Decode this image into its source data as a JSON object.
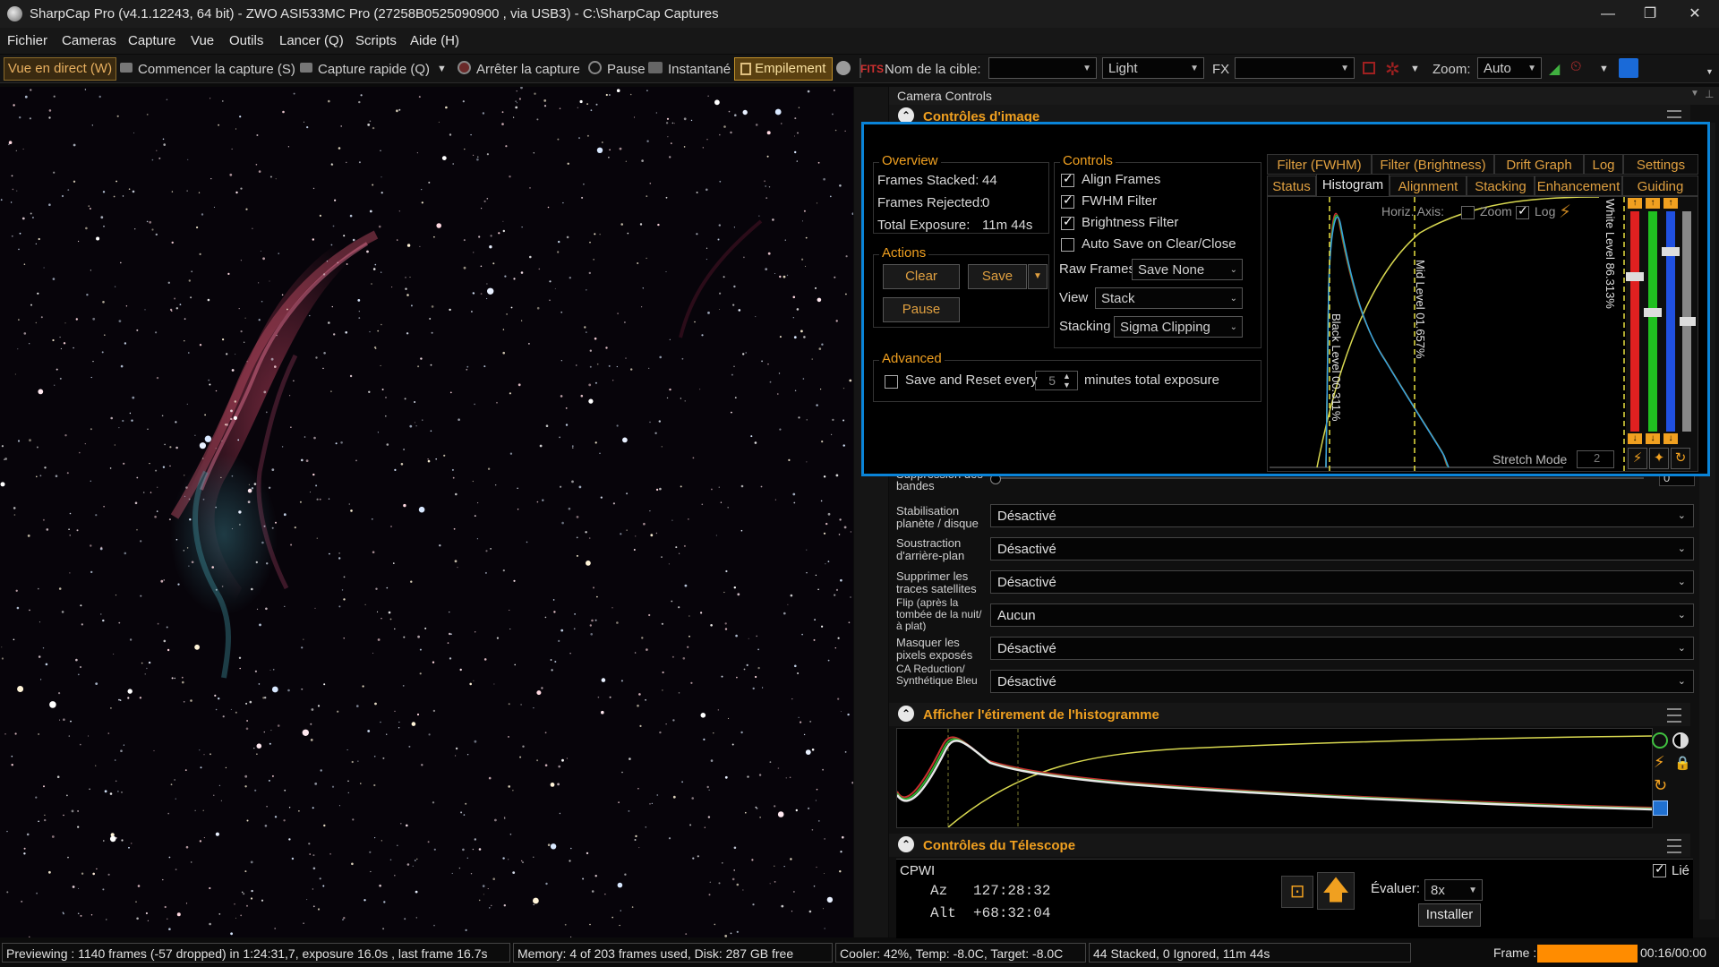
{
  "window": {
    "title": "SharpCap Pro (v4.1.12243, 64 bit) - ZWO ASI533MC Pro (27258B0525090900 , via USB3) - C:\\SharpCap Captures",
    "minimize": "—",
    "maximize": "❐",
    "close": "✕"
  },
  "menu": [
    "Fichier",
    "Cameras",
    "Capture",
    "Vue",
    "Outils",
    "Lancer (Q)",
    "Scripts",
    "Aide (H)"
  ],
  "toolbar": {
    "live_view": "Vue en direct (W)",
    "start_capture": "Commencer la capture (S)",
    "quick_capture": "Capture rapide (Q)",
    "stop_capture": "Arrêter la capture",
    "pause": "Pause",
    "snapshot": "Instantané",
    "live_stack": "Empilement",
    "target_name_label": "Nom de la cible:",
    "target_name_value": "",
    "frame_type": "Light",
    "fx_label": "FX",
    "fx_value": "",
    "zoom_label": "Zoom:",
    "zoom_value": "Auto"
  },
  "right_panel": {
    "header": "Camera Controls",
    "image_controls_title": "Contrôles d'image",
    "banding_label": "Suppression des bandes",
    "banding_value": "0",
    "rows": [
      {
        "label": "Stabilisation planète / disque",
        "value": "Désactivé"
      },
      {
        "label": "Soustraction d'arrière-plan",
        "value": "Désactivé"
      },
      {
        "label": "Supprimer les traces satellites",
        "value": "Désactivé"
      },
      {
        "label": "Flip (après la tombée de la nuit/à plat)",
        "value": "Aucun"
      },
      {
        "label": "Masquer les pixels exposés",
        "value": "Désactivé"
      },
      {
        "label": "CA Reduction/ Synthétique Bleu",
        "value": "Désactivé"
      }
    ],
    "histogram_stretch_title": "Afficher l'étirement de l'histogramme",
    "telescope_title": "Contrôles du Télescope",
    "telescope": {
      "mount": "CPWI",
      "linked_label": "Lié",
      "az": "Az   127:28:32",
      "alt": "Alt  +68:32:04",
      "rate_label": "Évaluer:",
      "rate_value": "8x",
      "install": "Installer"
    }
  },
  "live_stack": {
    "overview_title": "Overview",
    "frames_stacked_label": "Frames Stacked:",
    "frames_stacked": "44",
    "frames_rejected_label": "Frames Rejected:",
    "frames_rejected": "0",
    "total_exposure_label": "Total Exposure:",
    "total_exposure": "11m 44s",
    "actions_title": "Actions",
    "clear": "Clear",
    "save": "Save",
    "pause": "Pause",
    "advanced_title": "Advanced",
    "save_reset_label": "Save and Reset every",
    "save_reset_value": "5",
    "minutes_label": "minutes total exposure",
    "controls_title": "Controls",
    "align_frames": "Align Frames",
    "fwhm_filter": "FWHM Filter",
    "brightness_filter": "Brightness Filter",
    "auto_save": "Auto Save on Clear/Close",
    "raw_frames_label": "Raw Frames",
    "raw_frames_value": "Save None",
    "view_label": "View",
    "view_value": "Stack",
    "stacking_label": "Stacking",
    "stacking_value": "Sigma Clipping",
    "tabs_top": [
      "Filter (FWHM)",
      "Filter (Brightness)",
      "Drift Graph",
      "Log",
      "Settings"
    ],
    "tabs_bottom": [
      "Status",
      "Histogram",
      "Alignment",
      "Stacking",
      "Enhancement",
      "Guiding"
    ],
    "histogram": {
      "horiz_axis": "Horiz. Axis:",
      "zoom": "Zoom",
      "log": "Log",
      "black_level": "Black Level 00.311%",
      "mid_level": "Mid Level 01.657%",
      "white_level": "White Level 86.313%",
      "stretch_mode": "Stretch Mode",
      "stretch_value": "2"
    }
  },
  "status": {
    "previewing": "Previewing : 1140 frames (-57 dropped) in 1:24:31,7, exposure 16.0s , last frame 16.7s",
    "memory": "Memory: 4 of 203 frames used, Disk: 287 GB free",
    "cooler": "Cooler: 42%, Temp: -8.0C, Target: -8.0C",
    "stacked": "44 Stacked, 0 Ignored, 11m 44s",
    "frame_label": "Frame :",
    "frame_time": "00:16/00:00",
    "frame_progress": 1.0
  },
  "colors": {
    "accent": "#f0a020",
    "highlight_border": "#0a84d8",
    "progress": "#ff8c00"
  }
}
